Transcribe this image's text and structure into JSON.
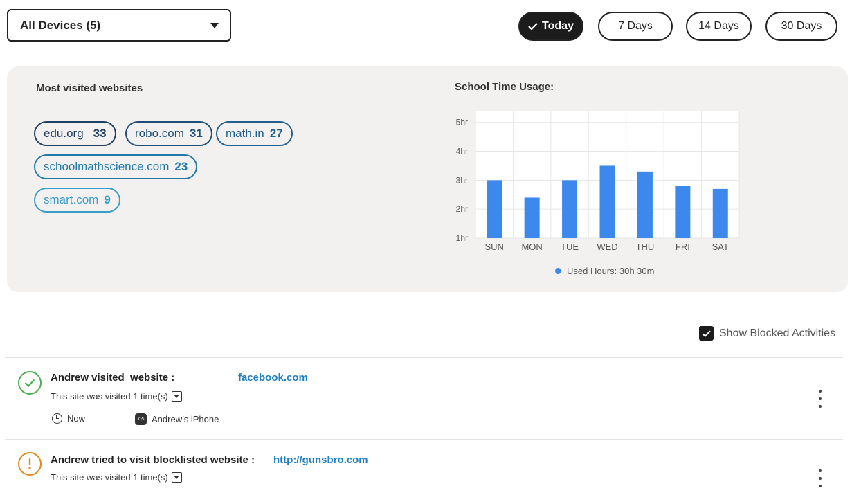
{
  "filters": {
    "device_select": "All Devices (5)",
    "ranges": [
      {
        "label": "Today",
        "active": true
      },
      {
        "label": "7 Days",
        "active": false
      },
      {
        "label": "14 Days",
        "active": false
      },
      {
        "label": "30 Days",
        "active": false
      }
    ]
  },
  "summary": {
    "websites_title": "Most visited websites",
    "websites": [
      {
        "domain": "edu.org",
        "count": "33",
        "color": "#1f3f63"
      },
      {
        "domain": "robo.com",
        "count": "31",
        "color": "#1f4f78"
      },
      {
        "domain": "math.in",
        "count": "27",
        "color": "#22618f"
      },
      {
        "domain": "schoolmathscience.com",
        "count": "23",
        "color": "#2279a8"
      },
      {
        "domain": "smart.com",
        "count": "9",
        "color": "#3a9cc9"
      }
    ],
    "usage_title": "School Time Usage:",
    "legend_label": "Used Hours: 30h 30m"
  },
  "chart_data": {
    "type": "bar",
    "title": "School Time Usage:",
    "categories": [
      "SUN",
      "MON",
      "TUE",
      "WED",
      "THU",
      "FRI",
      "SAT"
    ],
    "series": [
      {
        "name": "Used Hours: 30h 30m",
        "values": [
          3.0,
          2.4,
          3.0,
          3.5,
          3.3,
          2.8,
          2.7
        ]
      }
    ],
    "yticks": [
      "1hr",
      "2hr",
      "3hr",
      "4hr",
      "5hr"
    ],
    "ylim": [
      1,
      5.4
    ],
    "grid": true,
    "bar_color": "#3d88ec"
  },
  "activity": {
    "show_blocked_label": "Show Blocked Activities",
    "show_blocked_checked": true,
    "items": [
      {
        "status": "visited",
        "status_color": "#4caf50",
        "icon": "check-circle-icon",
        "title": "Andrew visited  website :",
        "link": "facebook.com",
        "visits": "This site was visited 1 time(s)",
        "time": "Now",
        "device": "Andrew’s iPhone",
        "device_badge": "iOS"
      },
      {
        "status": "blocked",
        "status_color": "#e08a1e",
        "icon": "warning-circle-icon",
        "title": "Andrew tried to visit blocklisted website :",
        "link": "http://gunsbro.com",
        "visits": "This site was visited 1 time(s)"
      }
    ]
  }
}
